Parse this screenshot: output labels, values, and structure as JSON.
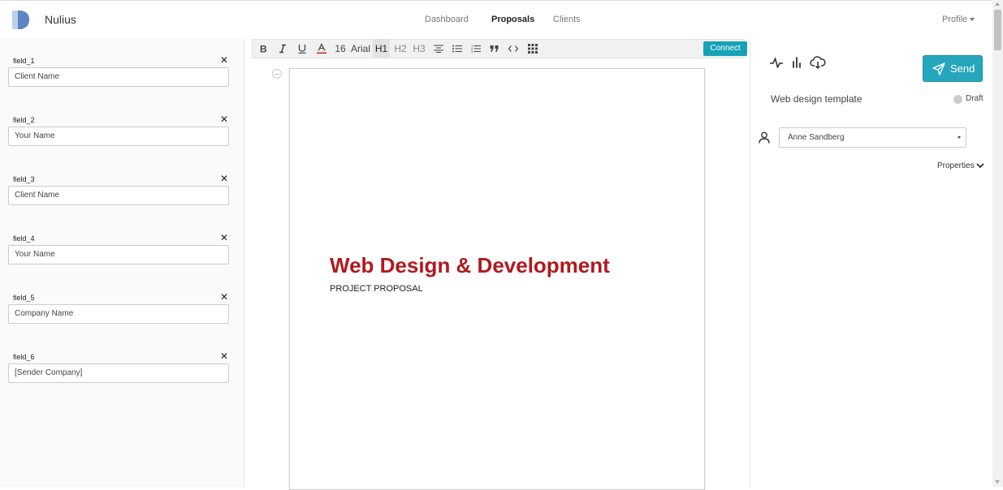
{
  "app": {
    "brand": "Nulius"
  },
  "nav": {
    "items": [
      "Dashboard",
      "Proposals",
      "Clients"
    ],
    "active": "Proposals",
    "profile": "Profile"
  },
  "fields": [
    {
      "label": "field_1",
      "value": "Client Name"
    },
    {
      "label": "field_2",
      "value": "Your Name"
    },
    {
      "label": "field_3",
      "value": "Client Name"
    },
    {
      "label": "field_4",
      "value": "Your Name"
    },
    {
      "label": "field_5",
      "value": "Company Name"
    },
    {
      "label": "field_6",
      "value": "[Sender Company]"
    }
  ],
  "toolbar": {
    "font_size": "16",
    "font_family": "Arial",
    "h1": "H1",
    "h2": "H2",
    "h3": "H3",
    "connect_label": "Connect"
  },
  "document": {
    "title": "Web Design & Development",
    "subtitle": "PROJECT PROPOSAL",
    "title_color": "#b0191e"
  },
  "sidebar": {
    "send_label": "Send",
    "template_name": "Web design template",
    "status": "Draft",
    "assignee": "Anne Sandberg",
    "properties_label": "Properties"
  },
  "colors": {
    "accent": "#26a6bd",
    "connect": "#17a2b8"
  }
}
